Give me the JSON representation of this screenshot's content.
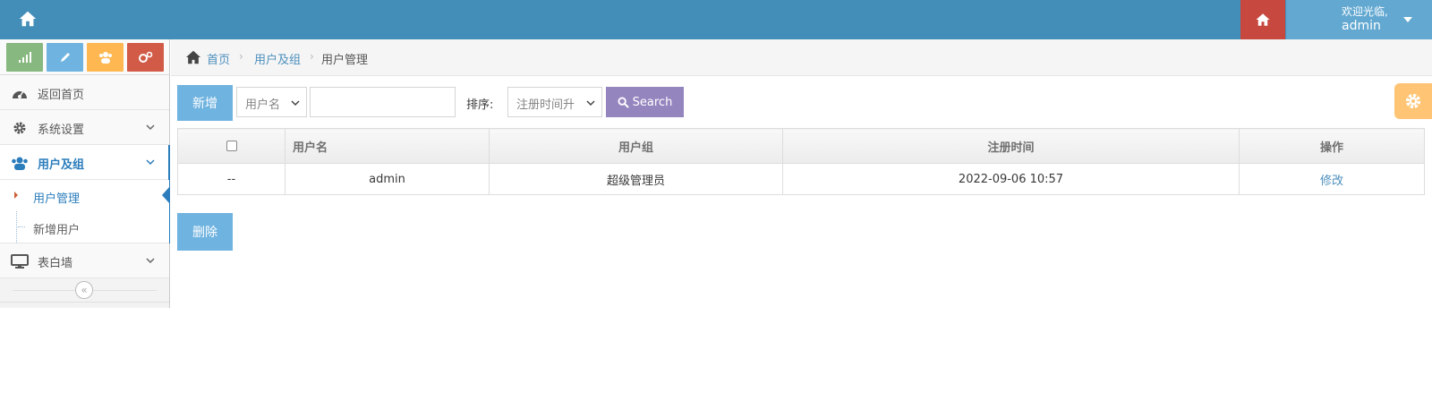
{
  "header": {
    "welcome": "欢迎光临,",
    "username": "admin"
  },
  "sidebar": {
    "items": [
      {
        "label": "返回首页",
        "icon": "dashboard-icon"
      },
      {
        "label": "系统设置",
        "icon": "gear-icon"
      },
      {
        "label": "用户及组",
        "icon": "users-icon"
      },
      {
        "label": "表白墙",
        "icon": "desktop-icon"
      }
    ],
    "submenu": [
      {
        "label": "用户管理",
        "active": true
      },
      {
        "label": "新增用户",
        "active": false
      }
    ],
    "collapse": "«"
  },
  "breadcrumb": {
    "home": "首页",
    "group": "用户及组",
    "current": "用户管理"
  },
  "toolbar": {
    "add_label": "新增",
    "field_select": "用户名",
    "search_value": "",
    "sort_label": "排序:",
    "sort_select": "注册时间升",
    "search_label": "Search"
  },
  "table": {
    "headers": [
      "",
      "用户名",
      "用户组",
      "注册时间",
      "操作"
    ],
    "rows": [
      {
        "select": "--",
        "username": "admin",
        "group": "超级管理员",
        "registered": "2022-09-06 10:57",
        "action": "修改"
      }
    ]
  },
  "footer": {
    "delete_label": "删除"
  },
  "colors": {
    "navbar": "#438eb9",
    "accent_blue": "#6fb3e0",
    "search_purple": "#9585bf",
    "danger_red": "#c6483e",
    "warning_orange": "#ffb752",
    "success_green": "#87b87f"
  }
}
